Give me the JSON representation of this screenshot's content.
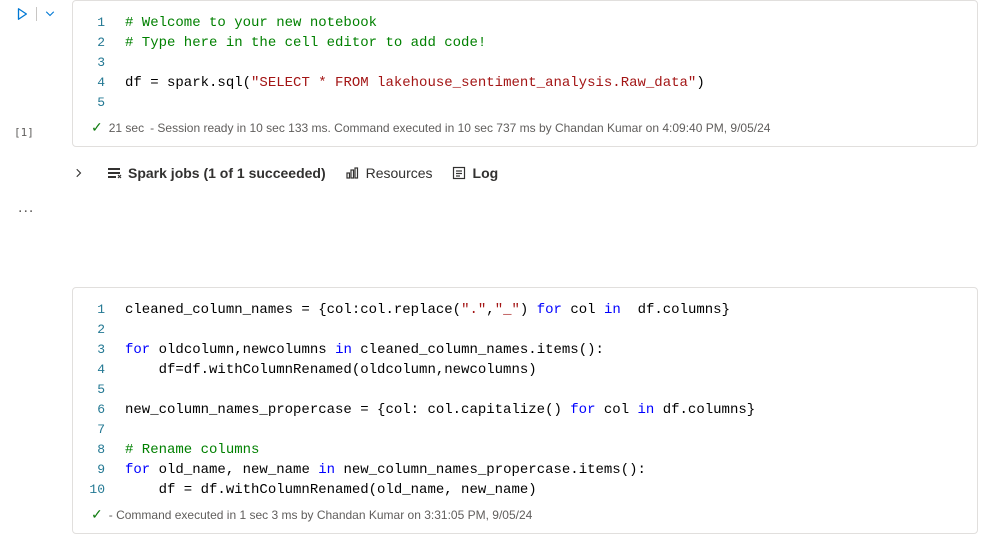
{
  "cell1": {
    "exec_label": "[1]",
    "lines": [
      {
        "n": "1",
        "segments": [
          {
            "cls": "tok-comment",
            "t": "# Welcome to your new notebook"
          }
        ]
      },
      {
        "n": "2",
        "segments": [
          {
            "cls": "tok-comment",
            "t": "# Type here in the cell editor to add code!"
          }
        ]
      },
      {
        "n": "3",
        "segments": []
      },
      {
        "n": "4",
        "segments": [
          {
            "cls": "tok-default",
            "t": "df = spark.sql("
          },
          {
            "cls": "tok-string",
            "t": "\"SELECT * FROM lakehouse_sentiment_analysis.Raw_data\""
          },
          {
            "cls": "tok-default",
            "t": ")"
          }
        ]
      },
      {
        "n": "5",
        "segments": []
      }
    ],
    "status_duration": "21 sec",
    "status_text": "- Session ready in 10 sec 133 ms. Command executed in 10 sec 737 ms by Chandan Kumar on 4:09:40 PM, 9/05/24"
  },
  "output": {
    "spark_jobs": "Spark jobs (1 of 1 succeeded)",
    "resources": "Resources",
    "log": "Log"
  },
  "more_dots": "...",
  "cell2": {
    "lines": [
      {
        "n": "1",
        "segments": [
          {
            "cls": "tok-default",
            "t": "cleaned_column_names = {col:col.replace("
          },
          {
            "cls": "tok-string",
            "t": "\".\""
          },
          {
            "cls": "tok-default",
            "t": ","
          },
          {
            "cls": "tok-string",
            "t": "\"_\""
          },
          {
            "cls": "tok-default",
            "t": ") "
          },
          {
            "cls": "tok-keyword",
            "t": "for"
          },
          {
            "cls": "tok-default",
            "t": " col "
          },
          {
            "cls": "tok-keyword",
            "t": "in"
          },
          {
            "cls": "tok-default",
            "t": "  df.columns}"
          }
        ]
      },
      {
        "n": "2",
        "segments": []
      },
      {
        "n": "3",
        "segments": [
          {
            "cls": "tok-keyword",
            "t": "for"
          },
          {
            "cls": "tok-default",
            "t": " oldcolumn,newcolumns "
          },
          {
            "cls": "tok-keyword",
            "t": "in"
          },
          {
            "cls": "tok-default",
            "t": " cleaned_column_names.items():"
          }
        ]
      },
      {
        "n": "4",
        "segments": [
          {
            "cls": "tok-default",
            "t": "    df=df.withColumnRenamed(oldcolumn,newcolumns)"
          }
        ]
      },
      {
        "n": "5",
        "segments": []
      },
      {
        "n": "6",
        "segments": [
          {
            "cls": "tok-default",
            "t": "new_column_names_propercase = {col: col.capitalize() "
          },
          {
            "cls": "tok-keyword",
            "t": "for"
          },
          {
            "cls": "tok-default",
            "t": " col "
          },
          {
            "cls": "tok-keyword",
            "t": "in"
          },
          {
            "cls": "tok-default",
            "t": " df.columns}"
          }
        ]
      },
      {
        "n": "7",
        "segments": []
      },
      {
        "n": "8",
        "segments": [
          {
            "cls": "tok-comment",
            "t": "# Rename columns"
          }
        ]
      },
      {
        "n": "9",
        "segments": [
          {
            "cls": "tok-keyword",
            "t": "for"
          },
          {
            "cls": "tok-default",
            "t": " old_name, new_name "
          },
          {
            "cls": "tok-keyword",
            "t": "in"
          },
          {
            "cls": "tok-default",
            "t": " new_column_names_propercase.items():"
          }
        ]
      },
      {
        "n": "10",
        "segments": [
          {
            "cls": "tok-default",
            "t": "    df = df.withColumnRenamed(old_name, new_name)"
          }
        ]
      }
    ],
    "status_text": "- Command executed in 1 sec 3 ms by Chandan Kumar on 3:31:05 PM, 9/05/24"
  }
}
